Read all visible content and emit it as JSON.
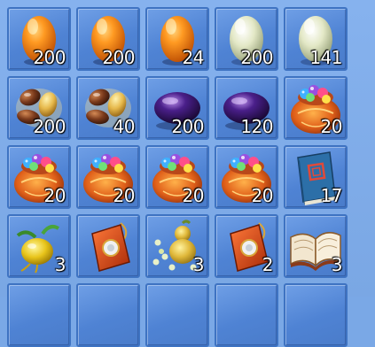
{
  "inventory": {
    "slots": [
      {
        "icon": "orange-egg-icon",
        "count": "200"
      },
      {
        "icon": "orange-egg-icon",
        "count": "200"
      },
      {
        "icon": "orange-egg-icon",
        "count": "24"
      },
      {
        "icon": "white-egg-icon",
        "count": "200"
      },
      {
        "icon": "white-egg-icon",
        "count": "141"
      },
      {
        "icon": "brown-beans-icon",
        "count": "200"
      },
      {
        "icon": "brown-beans-icon",
        "count": "40"
      },
      {
        "icon": "purple-bean-icon",
        "count": "200"
      },
      {
        "icon": "purple-bean-icon",
        "count": "120"
      },
      {
        "icon": "gem-bag-icon",
        "count": "20"
      },
      {
        "icon": "gem-bag-icon",
        "count": "20"
      },
      {
        "icon": "gem-bag-icon",
        "count": "20"
      },
      {
        "icon": "gem-bag-icon",
        "count": "20"
      },
      {
        "icon": "gem-bag-icon",
        "count": "20"
      },
      {
        "icon": "blue-book-icon",
        "count": "17"
      },
      {
        "icon": "golden-fruit-icon",
        "count": "3"
      },
      {
        "icon": "red-pouch-icon",
        "count": ""
      },
      {
        "icon": "gourd-seeds-icon",
        "count": "3"
      },
      {
        "icon": "red-pouch-icon",
        "count": "2"
      },
      {
        "icon": "open-book-icon",
        "count": "3"
      },
      {
        "icon": "",
        "count": ""
      },
      {
        "icon": "",
        "count": ""
      },
      {
        "icon": "",
        "count": ""
      },
      {
        "icon": "",
        "count": ""
      },
      {
        "icon": "",
        "count": ""
      }
    ]
  }
}
